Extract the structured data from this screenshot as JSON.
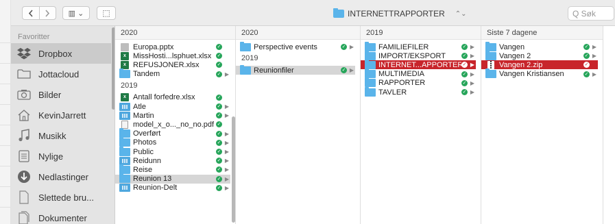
{
  "toolbar": {
    "back_icon": "chevron-left-icon",
    "forward_icon": "chevron-right-icon",
    "view_label": "▥ ⌄",
    "action_label": "⬚",
    "window_title": "INTERNETTRAPPORTER",
    "title_chevron": "⌃⌄",
    "search_placeholder": "Q Søk"
  },
  "sidebar": {
    "heading": "Favoritter",
    "items": [
      {
        "label": "Dropbox",
        "icon": "dropbox-icon",
        "selected": true
      },
      {
        "label": "Jottacloud",
        "icon": "folder-outline-icon",
        "selected": false
      },
      {
        "label": "Bilder",
        "icon": "camera-icon",
        "selected": false
      },
      {
        "label": "KevinJarrett",
        "icon": "home-icon",
        "selected": false
      },
      {
        "label": "Musikk",
        "icon": "music-note-icon",
        "selected": false
      },
      {
        "label": "Nylige",
        "icon": "recents-icon",
        "selected": false
      },
      {
        "label": "Nedlastinger",
        "icon": "download-icon",
        "selected": false
      },
      {
        "label": "Slettede bru...",
        "icon": "document-outline-icon",
        "selected": false
      },
      {
        "label": "Dokumenter",
        "icon": "documents-icon",
        "selected": false
      }
    ]
  },
  "columns": [
    {
      "header": "2020",
      "groups": [
        {
          "label": "",
          "rows": [
            {
              "name": "Europa.pptx",
              "type": "ppt",
              "arrow": false,
              "sel": ""
            },
            {
              "name": "MissHosti...lsphuet.xlsx",
              "type": "excel",
              "arrow": false,
              "sel": ""
            },
            {
              "name": "REFUSJONER.xlsx",
              "type": "excel",
              "arrow": false,
              "sel": ""
            },
            {
              "name": "Tandem",
              "type": "folder",
              "arrow": true,
              "sel": ""
            }
          ]
        },
        {
          "label": "2019",
          "rows": [
            {
              "name": "Antall forfedre.xlsx",
              "type": "excel",
              "arrow": false,
              "sel": ""
            },
            {
              "name": "Atle",
              "type": "shared",
              "arrow": true,
              "sel": ""
            },
            {
              "name": "Martin",
              "type": "shared",
              "arrow": true,
              "sel": ""
            },
            {
              "name": "model_x_o..._no_no.pdf",
              "type": "pdf",
              "arrow": false,
              "sel": ""
            },
            {
              "name": "Overført",
              "type": "folder",
              "arrow": true,
              "sel": ""
            },
            {
              "name": "Photos",
              "type": "folder",
              "arrow": true,
              "sel": ""
            },
            {
              "name": "Public",
              "type": "folder",
              "arrow": true,
              "sel": ""
            },
            {
              "name": "Reidunn",
              "type": "shared",
              "arrow": true,
              "sel": ""
            },
            {
              "name": "Reise",
              "type": "folder",
              "arrow": true,
              "sel": ""
            },
            {
              "name": "Reunion 13",
              "type": "folder",
              "arrow": true,
              "sel": "gray"
            },
            {
              "name": "Reunion-Delt",
              "type": "shared",
              "arrow": true,
              "sel": ""
            }
          ]
        }
      ]
    },
    {
      "header": "2020",
      "groups": [
        {
          "label": "",
          "rows": [
            {
              "name": "Perspective events",
              "type": "folder",
              "arrow": true,
              "sel": ""
            }
          ]
        },
        {
          "label": "2019",
          "rows": [
            {
              "name": "Reunionfiler",
              "type": "folder",
              "arrow": true,
              "sel": "gray"
            }
          ]
        }
      ]
    },
    {
      "header": "2019",
      "groups": [
        {
          "label": "",
          "rows": [
            {
              "name": "FAMILIEFILER",
              "type": "folder",
              "arrow": true,
              "sel": ""
            },
            {
              "name": "IMPORT/EKSPORT",
              "type": "folder",
              "arrow": true,
              "sel": ""
            },
            {
              "name": "INTERNET...APPORTER",
              "type": "folder",
              "arrow": true,
              "sel": "red"
            },
            {
              "name": "MULTIMEDIA",
              "type": "folder",
              "arrow": true,
              "sel": ""
            },
            {
              "name": "RAPPORTER",
              "type": "folder",
              "arrow": true,
              "sel": ""
            },
            {
              "name": "TAVLER",
              "type": "folder",
              "arrow": true,
              "sel": ""
            }
          ]
        }
      ]
    },
    {
      "header": "Siste 7 dagene",
      "groups": [
        {
          "label": "",
          "rows": [
            {
              "name": "Vangen",
              "type": "folder",
              "arrow": true,
              "sel": ""
            },
            {
              "name": "Vangen 2",
              "type": "folder",
              "arrow": true,
              "sel": ""
            },
            {
              "name": "Vangen 2.zip",
              "type": "zip",
              "arrow": false,
              "sel": "red"
            },
            {
              "name": "Vangen Kristiansen",
              "type": "folder",
              "arrow": true,
              "sel": ""
            }
          ]
        }
      ]
    }
  ]
}
